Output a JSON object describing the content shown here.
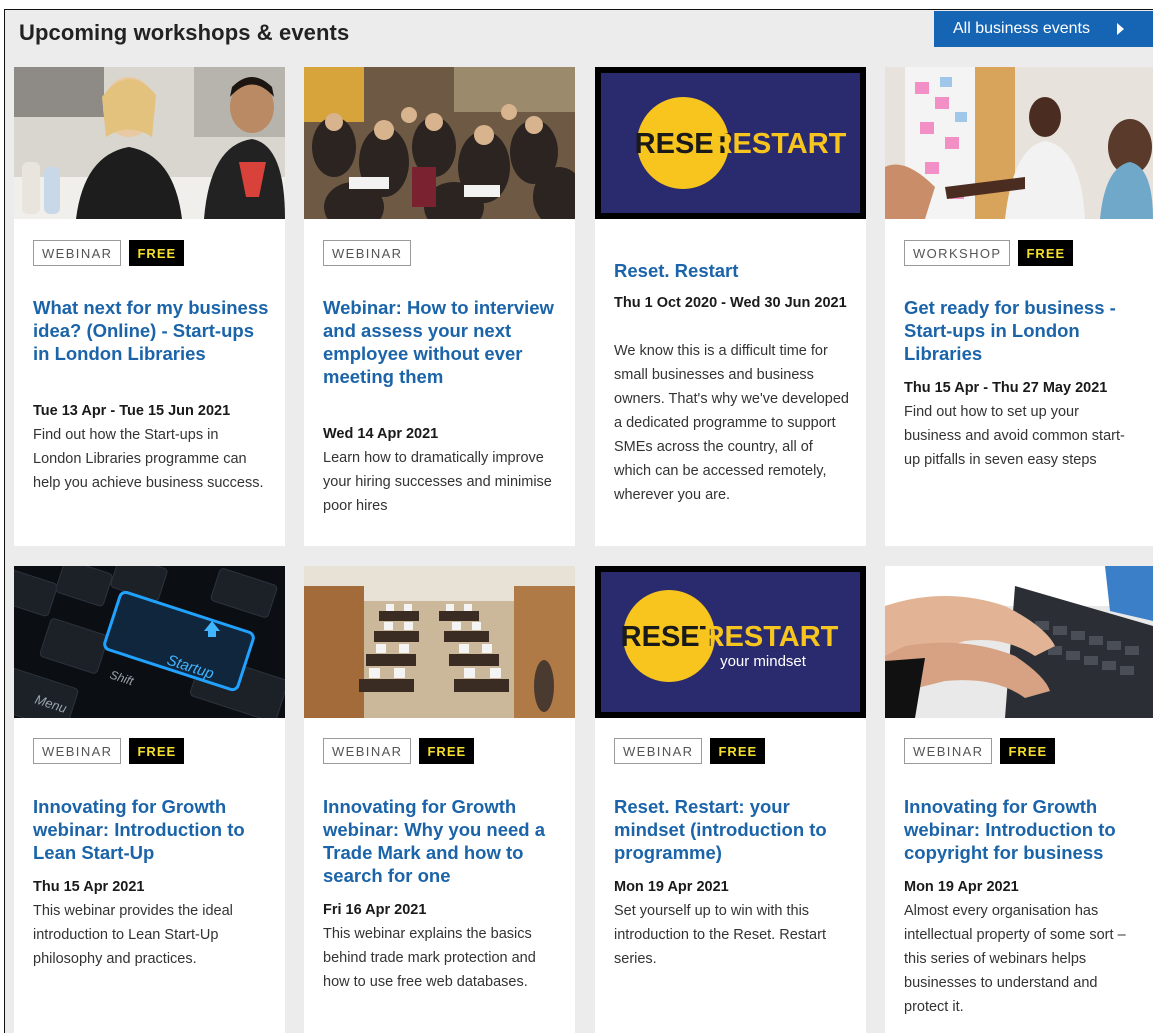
{
  "header": {
    "title": "Upcoming workshops & events",
    "all_events_label": "All business events"
  },
  "events": [
    {
      "type": "WEBINAR",
      "free": "FREE",
      "title": "What next for my business idea? (Online) - Start-ups in London Libraries",
      "date": "Tue 13 Apr - Tue 15 Jun 2021",
      "description": "Find out how the Start-ups in London Libraries programme can help you achieve business success."
    },
    {
      "type": "WEBINAR",
      "free": "",
      "title": "Webinar: How to interview and assess your next employee without ever meeting them",
      "date": "Wed 14 Apr 2021",
      "description": "Learn how to dramatically improve your hiring successes and minimise poor hires"
    },
    {
      "type": "",
      "free": "",
      "title": "Reset. Restart",
      "date": "Thu 1 Oct 2020 - Wed 30 Jun 2021",
      "description": "We know this is a difficult time for small businesses and business owners. That's why we've developed a dedicated programme to support SMEs across the country, all of which can be accessed remotely, wherever you are.",
      "logo_word1": "RESET",
      "logo_word2": "RESTART"
    },
    {
      "type": "WORKSHOP",
      "free": "FREE",
      "title": "Get ready for business - Start-ups in London Libraries",
      "date": "Thu 15 Apr - Thu 27 May 2021",
      "description": "Find out how to set up your business and avoid common start-up pitfalls in seven easy steps"
    },
    {
      "type": "WEBINAR",
      "free": "FREE",
      "title": "Innovating for Growth webinar: Introduction to Lean Start-Up",
      "date": "Thu 15 Apr 2021",
      "description": "This webinar provides the ideal introduction to Lean Start-Up philosophy and practices.",
      "key_startup": "Startup",
      "key_shift": "Shift",
      "key_menu": "Menu"
    },
    {
      "type": "WEBINAR",
      "free": "FREE",
      "title": "Innovating for Growth webinar: Why you need a Trade Mark and how to search for one",
      "date": "Fri 16 Apr 2021",
      "description": "This webinar explains the basics behind trade mark protection and how to use free web databases."
    },
    {
      "type": "WEBINAR",
      "free": "FREE",
      "title": "Reset. Restart: your mindset (introduction to programme)",
      "date": "Mon 19 Apr 2021",
      "description": "Set yourself up to win with this introduction to the Reset. Restart series.",
      "logo_word1": "RESET",
      "logo_word2": "RESTART",
      "logo_sub": "your mindset"
    },
    {
      "type": "WEBINAR",
      "free": "FREE",
      "title": "Innovating for Growth webinar: Introduction to copyright for business",
      "date": "Mon 19 Apr 2021",
      "description": "Almost every organisation has intellectual property of some sort – this series of webinars helps businesses to understand and protect it."
    }
  ],
  "colors": {
    "accent_blue": "#1565b4",
    "title_blue": "#1b64a9",
    "free_badge_text": "#f4df2c",
    "reset_navy": "#2a2a6e",
    "reset_yellow": "#f7c51e"
  }
}
